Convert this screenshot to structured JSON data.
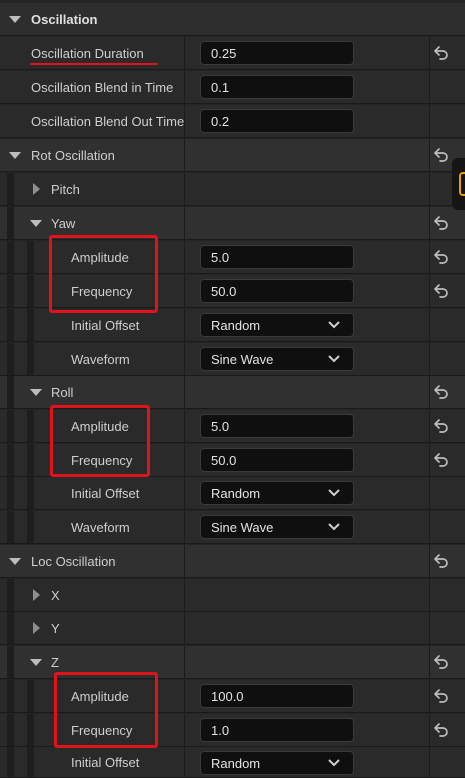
{
  "sections": {
    "oscillation": "Oscillation",
    "rot_oscillation": "Rot Oscillation",
    "loc_oscillation": "Loc Oscillation"
  },
  "props": {
    "duration": {
      "label": "Oscillation Duration",
      "value": "0.25"
    },
    "blend_in": {
      "label": "Oscillation Blend in Time",
      "value": "0.1"
    },
    "blend_out": {
      "label": "Oscillation Blend Out Time",
      "value": "0.2"
    }
  },
  "rot": {
    "pitch": "Pitch",
    "yaw": {
      "label": "Yaw",
      "amplitude": {
        "label": "Amplitude",
        "value": "5.0"
      },
      "frequency": {
        "label": "Frequency",
        "value": "50.0"
      },
      "initial_offset": {
        "label": "Initial Offset",
        "value": "Random"
      },
      "waveform": {
        "label": "Waveform",
        "value": "Sine Wave"
      }
    },
    "roll": {
      "label": "Roll",
      "amplitude": {
        "label": "Amplitude",
        "value": "5.0"
      },
      "frequency": {
        "label": "Frequency",
        "value": "50.0"
      },
      "initial_offset": {
        "label": "Initial Offset",
        "value": "Random"
      },
      "waveform": {
        "label": "Waveform",
        "value": "Sine Wave"
      }
    }
  },
  "loc": {
    "x": "X",
    "y": "Y",
    "z": {
      "label": "Z",
      "amplitude": {
        "label": "Amplitude",
        "value": "100.0"
      },
      "frequency": {
        "label": "Frequency",
        "value": "1.0"
      },
      "initial_offset": {
        "label": "Initial Offset",
        "value": "Random"
      }
    }
  },
  "colors": {
    "highlight": "#e0131d",
    "panel_bg": "#242424",
    "field_bg": "#0f0f0f",
    "tab_accent": "#e8a200"
  },
  "icons": {
    "reset": "reset-to-default-icon",
    "expand": "expand-arrow-icon",
    "collapsed": "collapsed-arrow-icon",
    "dropdown": "chevron-down-icon"
  }
}
